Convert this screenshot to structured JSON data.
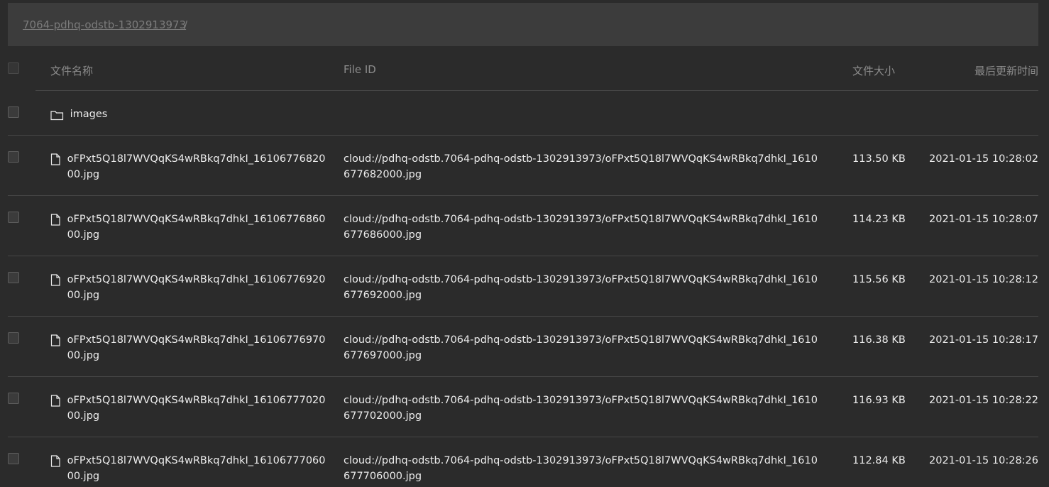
{
  "breadcrumb": {
    "root": "7064-pdhq-odstb-1302913973",
    "separator": "/"
  },
  "table": {
    "headers": {
      "name": "文件名称",
      "file_id": "File ID",
      "size": "文件大小",
      "updated": "最后更新时间"
    },
    "folder": {
      "name": "images",
      "icon": "folder-icon"
    },
    "files": [
      {
        "name": "oFPxt5Q18l7WVQqKS4wRBkq7dhkI_1610677682000.jpg",
        "file_id": "cloud://pdhq-odstb.7064-pdhq-odstb-1302913973/oFPxt5Q18l7WVQqKS4wRBkq7dhkI_1610677682000.jpg",
        "size": "113.50 KB",
        "updated": "2021-01-15 10:28:02",
        "icon": "file-icon"
      },
      {
        "name": "oFPxt5Q18l7WVQqKS4wRBkq7dhkI_1610677686000.jpg",
        "file_id": "cloud://pdhq-odstb.7064-pdhq-odstb-1302913973/oFPxt5Q18l7WVQqKS4wRBkq7dhkI_1610677686000.jpg",
        "size": "114.23 KB",
        "updated": "2021-01-15 10:28:07",
        "icon": "file-icon"
      },
      {
        "name": "oFPxt5Q18l7WVQqKS4wRBkq7dhkI_1610677692000.jpg",
        "file_id": "cloud://pdhq-odstb.7064-pdhq-odstb-1302913973/oFPxt5Q18l7WVQqKS4wRBkq7dhkI_1610677692000.jpg",
        "size": "115.56 KB",
        "updated": "2021-01-15 10:28:12",
        "icon": "file-icon"
      },
      {
        "name": "oFPxt5Q18l7WVQqKS4wRBkq7dhkI_1610677697000.jpg",
        "file_id": "cloud://pdhq-odstb.7064-pdhq-odstb-1302913973/oFPxt5Q18l7WVQqKS4wRBkq7dhkI_1610677697000.jpg",
        "size": "116.38 KB",
        "updated": "2021-01-15 10:28:17",
        "icon": "file-icon"
      },
      {
        "name": "oFPxt5Q18l7WVQqKS4wRBkq7dhkI_1610677702000.jpg",
        "file_id": "cloud://pdhq-odstb.7064-pdhq-odstb-1302913973/oFPxt5Q18l7WVQqKS4wRBkq7dhkI_1610677702000.jpg",
        "size": "116.93 KB",
        "updated": "2021-01-15 10:28:22",
        "icon": "file-icon"
      },
      {
        "name": "oFPxt5Q18l7WVQqKS4wRBkq7dhkI_1610677706000.jpg",
        "file_id": "cloud://pdhq-odstb.7064-pdhq-odstb-1302913973/oFPxt5Q18l7WVQqKS4wRBkq7dhkI_1610677706000.jpg",
        "size": "112.84 KB",
        "updated": "2021-01-15 10:28:26",
        "icon": "file-icon"
      }
    ]
  },
  "colors": {
    "background": "#2b2b2b",
    "breadcrumb_bar": "#3c3c3c",
    "text": "#ececec",
    "muted": "#8c8c8c",
    "divider": "#464646"
  }
}
